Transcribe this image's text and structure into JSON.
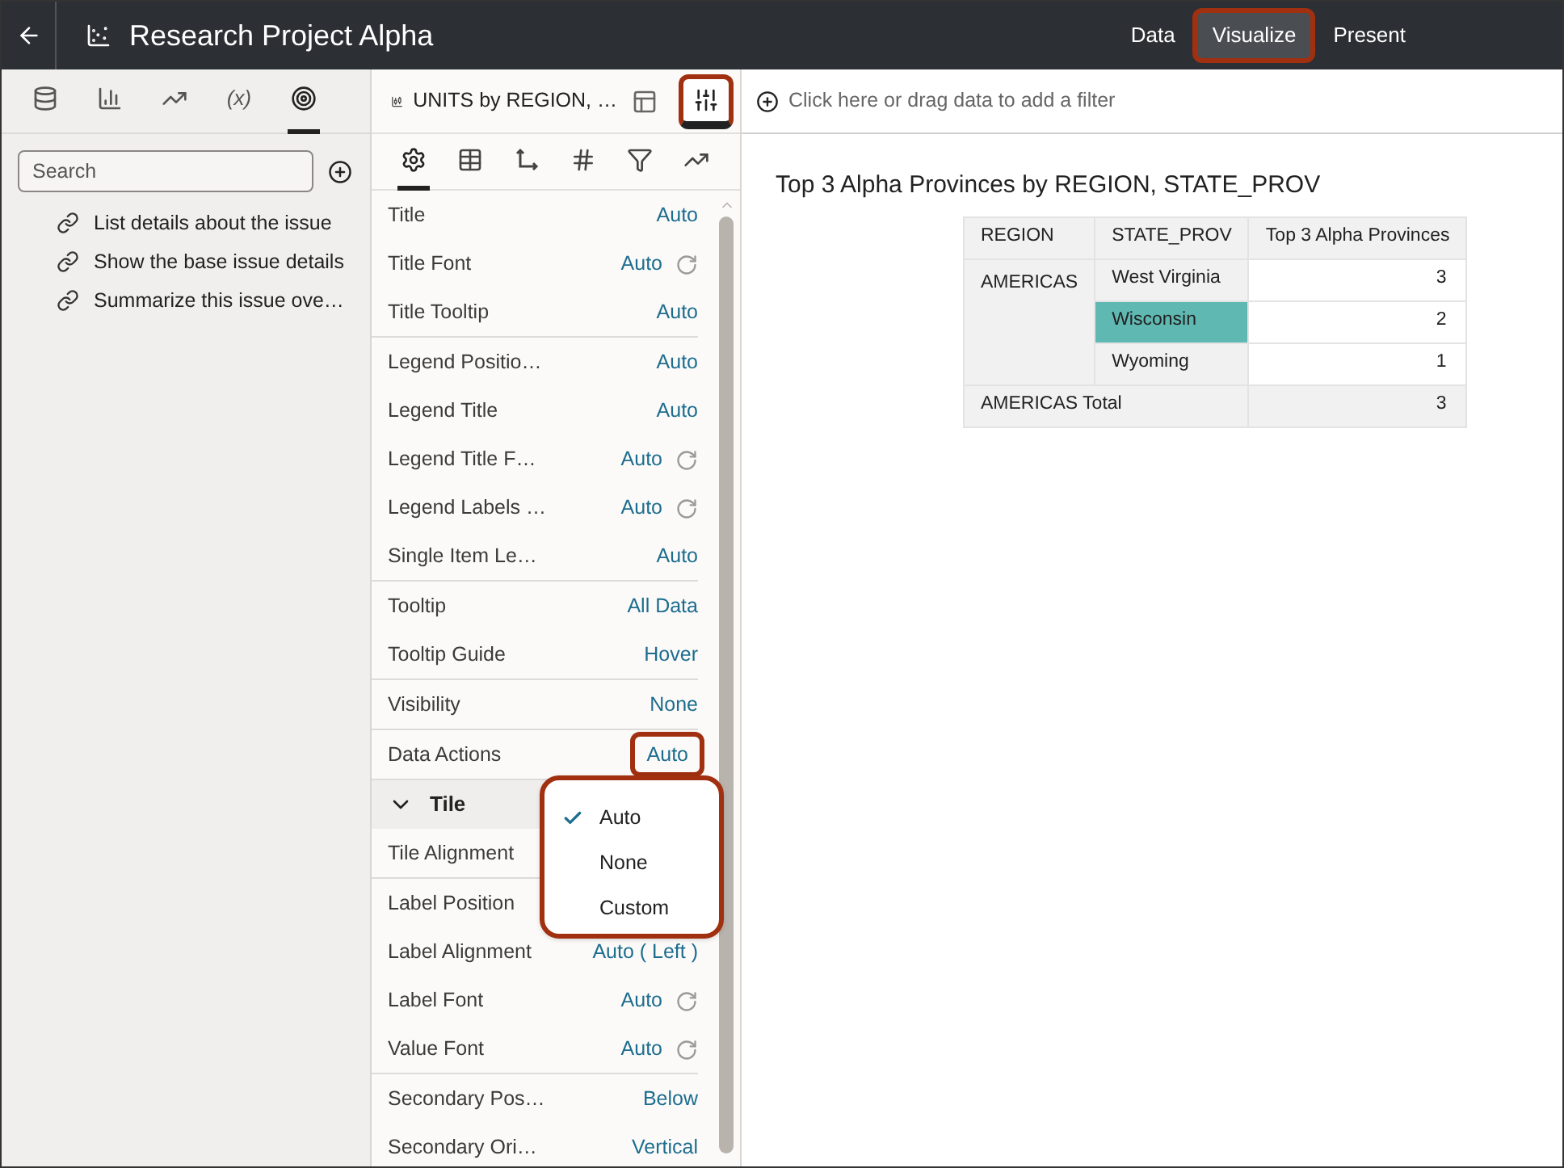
{
  "header": {
    "title": "Research Project Alpha",
    "tabs": [
      {
        "label": "Data",
        "selected": false,
        "highlighted": false
      },
      {
        "label": "Visualize",
        "selected": true,
        "highlighted": true
      },
      {
        "label": "Present",
        "selected": false,
        "highlighted": false
      }
    ]
  },
  "left_panel": {
    "tabs": [
      {
        "kind": "database",
        "selected": false
      },
      {
        "kind": "chart",
        "selected": false
      },
      {
        "kind": "trend",
        "selected": false
      },
      {
        "kind": "text",
        "label": "(x)",
        "selected": false
      },
      {
        "kind": "target",
        "selected": true
      }
    ],
    "search": {
      "placeholder": "Search"
    },
    "items": [
      "List details about the issue",
      "Show the base issue details",
      "Summarize this issue ove…"
    ]
  },
  "middle_panel": {
    "title": "UNITS by REGION, …",
    "buttons": [
      {
        "kind": "layout",
        "selected": false,
        "highlighted": false
      },
      {
        "kind": "properties",
        "selected": true,
        "highlighted": true
      }
    ],
    "tabs": [
      {
        "kind": "settings",
        "selected": true
      },
      {
        "kind": "table",
        "selected": false
      },
      {
        "kind": "axis",
        "selected": false
      },
      {
        "kind": "number",
        "selected": false
      },
      {
        "kind": "filter",
        "selected": false
      },
      {
        "kind": "trend",
        "selected": false
      }
    ],
    "groups": [
      [
        {
          "label": "Title",
          "value": "Auto",
          "reset": false
        },
        {
          "label": "Title Font",
          "value": "Auto",
          "reset": true
        },
        {
          "label": "Title Tooltip",
          "value": "Auto",
          "reset": false
        }
      ],
      [
        {
          "label": "Legend Positio…",
          "value": "Auto",
          "reset": false
        },
        {
          "label": "Legend Title",
          "value": "Auto",
          "reset": false
        },
        {
          "label": "Legend Title F…",
          "value": "Auto",
          "reset": true
        },
        {
          "label": "Legend Labels …",
          "value": "Auto",
          "reset": true
        },
        {
          "label": "Single Item Le…",
          "value": "Auto",
          "reset": false
        }
      ],
      [
        {
          "label": "Tooltip",
          "value": "All Data",
          "reset": false
        },
        {
          "label": "Tooltip Guide",
          "value": "Hover",
          "reset": false
        }
      ],
      [
        {
          "label": "Visibility",
          "value": "None",
          "reset": false
        }
      ],
      [
        {
          "label": "Data Actions",
          "value": "Auto",
          "reset": false,
          "highlighted": true
        }
      ]
    ],
    "sections": [
      {
        "title": "Tile",
        "expanded": true,
        "groups": [
          [
            {
              "label": "Tile Alignment"
            }
          ],
          [
            {
              "label": "Label Position"
            },
            {
              "label": "Label Alignment",
              "value": "Auto ( Left )",
              "reset": false
            },
            {
              "label": "Label Font",
              "value": "Auto",
              "reset": true
            },
            {
              "label": "Value Font",
              "value": "Auto",
              "reset": true
            }
          ],
          [
            {
              "label": "Secondary Pos…",
              "value": "Below",
              "reset": false
            },
            {
              "label": "Secondary Ori…",
              "value": "Vertical",
              "reset": false
            }
          ]
        ]
      }
    ],
    "menu": {
      "highlighted": true,
      "options": [
        {
          "label": "Auto",
          "selected": true
        },
        {
          "label": "None",
          "selected": false
        },
        {
          "label": "Custom",
          "selected": false
        }
      ]
    }
  },
  "canvas": {
    "filter_hint": "Click here or drag data to add a filter",
    "title": "Top 3 Alpha Provinces by REGION, STATE_PROV",
    "table": {
      "columns": [
        "REGION",
        "STATE_PROV",
        "Top 3 Alpha Provinces"
      ],
      "rows": [
        {
          "region": "AMERICAS",
          "state": "West Virginia",
          "value": "3",
          "selected": false
        },
        {
          "state": "Wisconsin",
          "value": "2",
          "selected": true
        },
        {
          "state": "Wyoming",
          "value": "1",
          "selected": false
        }
      ],
      "total": {
        "label": "AMERICAS Total",
        "value": "3"
      }
    }
  }
}
